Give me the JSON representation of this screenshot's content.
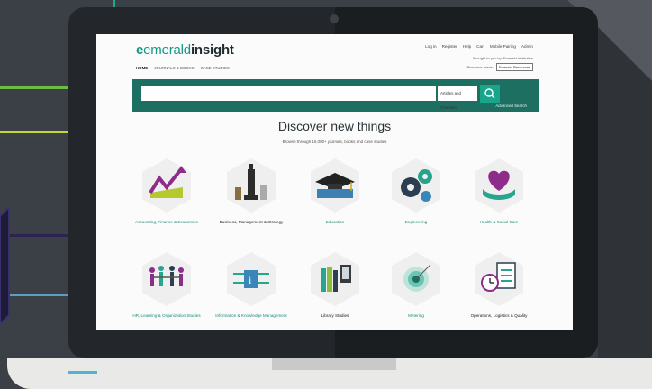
{
  "colors": {
    "accent": "#17a58c",
    "band": "#1d6f62",
    "frame": "#23272b",
    "brand": "#119a82"
  },
  "site": {
    "logo_prefix": "e",
    "logo_emerald": "emerald",
    "logo_insight": "insight",
    "top_links": [
      "Log in",
      "Register",
      "Help",
      "Cart",
      "Mobile Pairing",
      "Admin"
    ],
    "nav": [
      "HOME",
      "JOURNALS & BOOKS",
      "CASE STUDIES"
    ],
    "brought_to_you": "Brought to you by: Emerald Institution",
    "resource_area_label": "Resource areas:",
    "resource_area_value": "Emerald Resources"
  },
  "search": {
    "placeholder": "",
    "scope": "Articles and Chapters",
    "advanced": "Advanced Search"
  },
  "discover": {
    "title": "Discover new things",
    "subtitle": "Browse through 15,000+ journals, books and case studies"
  },
  "categories": [
    {
      "label": "Accounting, Finance & Economics",
      "icon": "rising-chart-icon"
    },
    {
      "label": "Business, Management & Strategy",
      "icon": "chess-pieces-icon"
    },
    {
      "label": "Education",
      "icon": "graduation-cap-icon"
    },
    {
      "label": "Engineering",
      "icon": "gears-icon"
    },
    {
      "label": "Health & Social Care",
      "icon": "heart-hands-icon"
    },
    {
      "label": "HR, Learning & Organization Studies",
      "icon": "people-chain-icon"
    },
    {
      "label": "Information & Knowledge Management",
      "icon": "circuit-icon"
    },
    {
      "label": "Library Studies",
      "icon": "books-icon"
    },
    {
      "label": "Metering",
      "icon": "target-icon"
    },
    {
      "label": "Operations, Logistics & Quality",
      "icon": "clock-checklist-icon"
    }
  ]
}
